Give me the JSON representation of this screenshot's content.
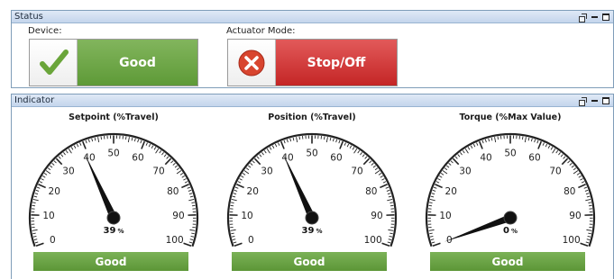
{
  "status": {
    "title": "Status",
    "device_label": "Device:",
    "device_value": "Good",
    "actuator_label": "Actuator Mode:",
    "actuator_value": "Stop/Off"
  },
  "indicator": {
    "title": "Indicator",
    "gauges": [
      {
        "title": "Setpoint (%Travel)",
        "value": 39,
        "unit": "%",
        "status": "Good"
      },
      {
        "title": "Position (%Travel)",
        "value": 39,
        "unit": "%",
        "status": "Good"
      },
      {
        "title": "Torque (%Max Value)",
        "value": 0,
        "unit": "%",
        "status": "Good"
      }
    ],
    "scale_labels": [
      "0",
      "10",
      "20",
      "30",
      "40",
      "50",
      "60",
      "70",
      "80",
      "90",
      "100"
    ]
  },
  "colors": {
    "good": "#6aa545",
    "bad": "#d03535",
    "header": "#c4d5ec"
  },
  "icons": {
    "device": "check-icon",
    "actuator": "error-x-icon"
  }
}
